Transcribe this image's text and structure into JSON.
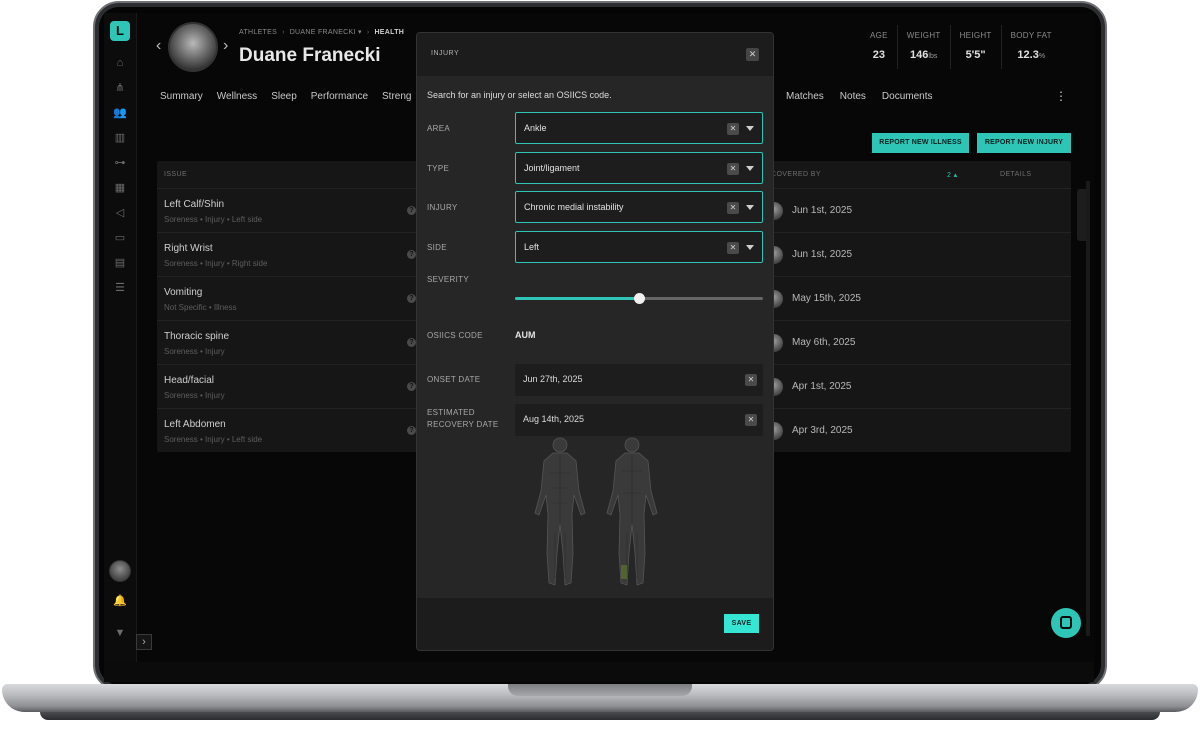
{
  "app": {
    "logo_letter": "L"
  },
  "breadcrumb": {
    "items": [
      "ATHLETES",
      "DUANE FRANECKI ▾",
      "HEALTH"
    ]
  },
  "athlete": {
    "name": "Duane Franecki"
  },
  "stats": [
    {
      "label": "AGE",
      "value": "23",
      "unit": ""
    },
    {
      "label": "WEIGHT",
      "value": "146",
      "unit": "lbs"
    },
    {
      "label": "HEIGHT",
      "value": "5'5\"",
      "unit": ""
    },
    {
      "label": "BODY FAT",
      "value": "12.3",
      "unit": "%"
    }
  ],
  "tabs": [
    "Summary",
    "Wellness",
    "Sleep",
    "Performance",
    "Streng"
  ],
  "tabs_right": [
    "Matches",
    "Notes",
    "Documents"
  ],
  "buttons": {
    "report_illness": "REPORT NEW ILLNESS",
    "report_injury": "REPORT NEW INJURY"
  },
  "table": {
    "headers": {
      "issue": "ISSUE",
      "recovered_by": "COVERED BY",
      "sort_count": "2 ▴",
      "details": "DETAILS"
    },
    "rows": [
      {
        "title": "Left Calf/Shin",
        "sub": "Soreness • Injury • Left side",
        "date": "Jun 1st, 2025"
      },
      {
        "title": "Right Wrist",
        "sub": "Soreness • Injury • Right side",
        "date": "Jun 1st, 2025"
      },
      {
        "title": "Vomiting",
        "sub": "Not Specific • Illness",
        "date": "May 15th, 2025"
      },
      {
        "title": "Thoracic spine",
        "sub": "Soreness • Injury",
        "date": "May 6th, 2025"
      },
      {
        "title": "Head/facial",
        "sub": "Soreness • Injury",
        "date": "Apr 1st, 2025"
      },
      {
        "title": "Left Abdomen",
        "sub": "Soreness • Injury • Left side",
        "date": "Apr 3rd, 2025"
      }
    ]
  },
  "modal": {
    "title": "INJURY",
    "instruction": "Search for an injury or select an OSIICS code.",
    "fields": {
      "area": {
        "label": "AREA",
        "value": "Ankle"
      },
      "type": {
        "label": "TYPE",
        "value": "Joint/ligament"
      },
      "injury": {
        "label": "INJURY",
        "value": "Chronic medial instability"
      },
      "side": {
        "label": "SIDE",
        "value": "Left"
      }
    },
    "severity": {
      "label": "SEVERITY",
      "value_fraction": 0.5
    },
    "osiics": {
      "label": "OSIICS CODE",
      "value": "AUM"
    },
    "onset": {
      "label": "ONSET DATE",
      "value": "Jun 27th, 2025"
    },
    "recovery": {
      "label_line1": "ESTIMATED",
      "label_line2": "RECOVERY DATE",
      "value": "Aug 14th, 2025"
    },
    "save_label": "SAVE"
  },
  "colors": {
    "accent": "#2ec4b6",
    "save": "#35e6d5",
    "highlight": "#556b2f"
  }
}
